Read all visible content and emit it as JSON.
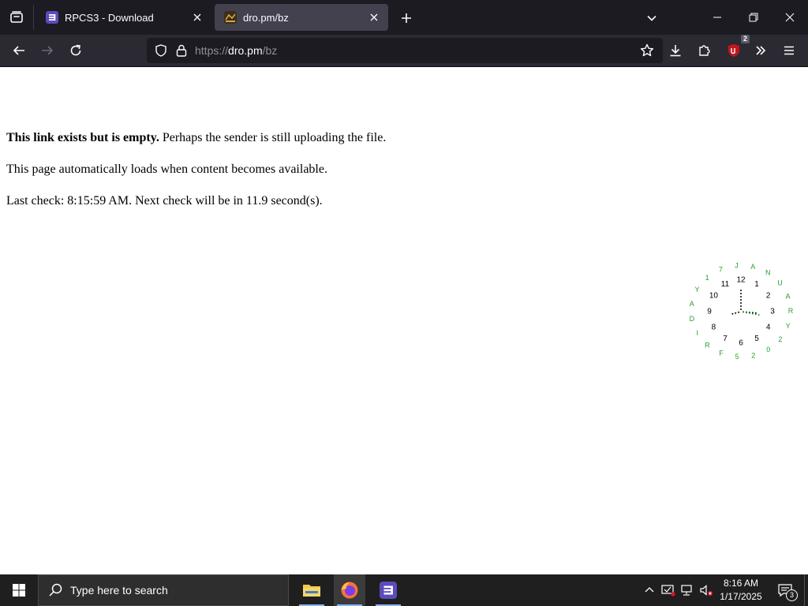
{
  "browser": {
    "tabs": [
      {
        "title": "RPCS3 - Download",
        "active": false,
        "favicon": "rpcs3-icon"
      },
      {
        "title": "dro.pm/bz",
        "active": true,
        "favicon": "site-favicon"
      }
    ],
    "url": {
      "scheme": "https://",
      "host": "dro.pm",
      "path": "/bz"
    },
    "extension_badge": "2"
  },
  "page": {
    "line1_bold": "This link exists but is empty.",
    "line1_rest": " Perhaps the sender is still uploading the file.",
    "line2": "This page automatically loads when content becomes available.",
    "line3": "Last check: 8:15:59 AM. Next check will be in 11.9 second(s).",
    "clock": {
      "hour_numbers": [
        "12",
        "1",
        "2",
        "3",
        "4",
        "5",
        "6",
        "7",
        "8",
        "9",
        "10",
        "11"
      ],
      "date_letters": [
        "J",
        "A",
        "N",
        "U",
        "A",
        "R",
        "Y",
        "2",
        "0",
        "2",
        "5",
        "F",
        "R",
        "I",
        "D",
        "A",
        "Y",
        "1",
        "7"
      ],
      "date_color": "#2a9d2a"
    }
  },
  "taskbar": {
    "search_placeholder": "Type here to search",
    "time": "8:16 AM",
    "date": "1/17/2025",
    "notifications": "3"
  },
  "colors": {
    "tab_bg": "#1c1b22",
    "toolbar_bg": "#2b2a33",
    "active_tab": "#42414d",
    "taskbar_bg": "#1f1f1f",
    "ublock": "#c4161c"
  }
}
